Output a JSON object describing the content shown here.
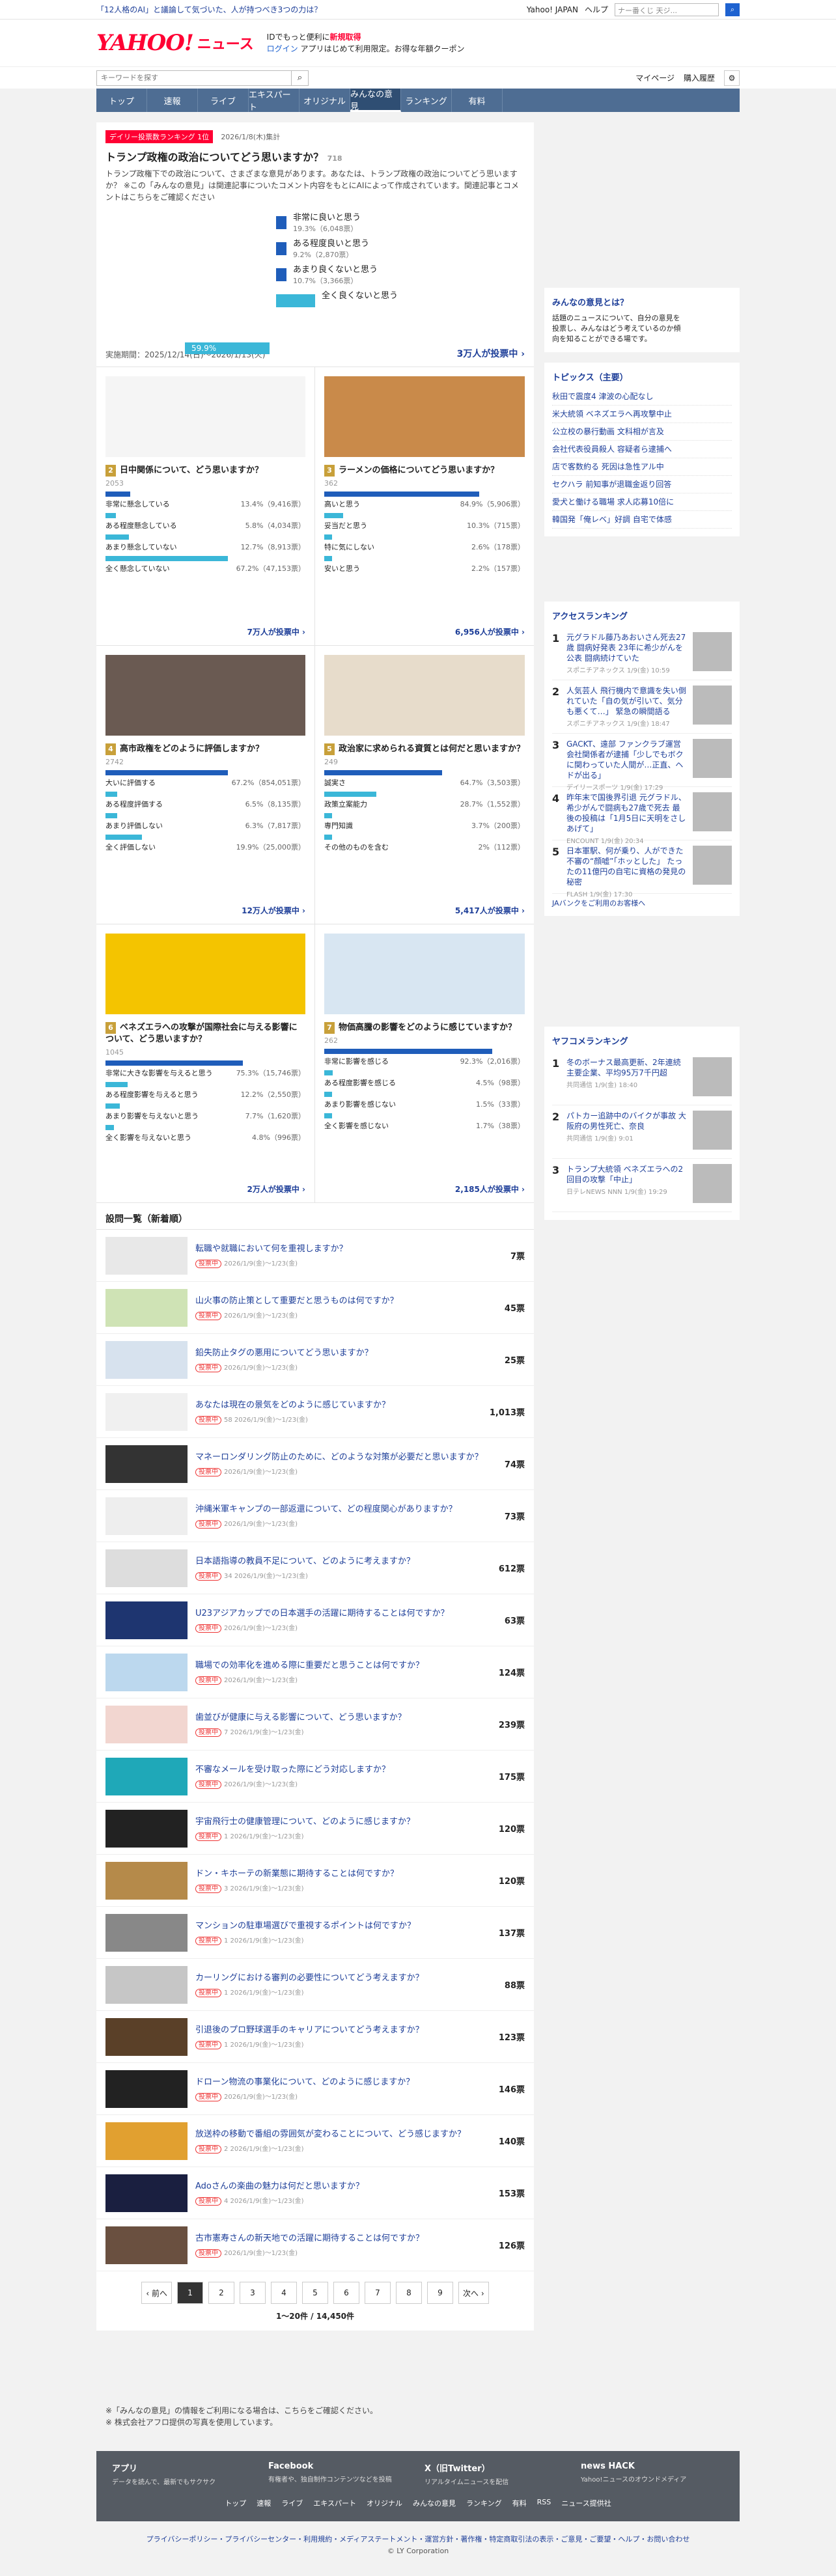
{
  "topbar": {
    "ad": "「12人格のAI」と議論して気づいた、人が持つべき3つの力は？",
    "links": [
      "Yahoo! JAPAN",
      "ヘルプ"
    ],
    "search_placeholder": "ウェブ検索",
    "search_hint": "ナー番くじ 天ジ..."
  },
  "header": {
    "logo": "YAHOO!",
    "logo_sub": "JAPAN",
    "service": "ニュース",
    "promo1": "IDでもっと便利に",
    "promo1b": "新規取得",
    "promo2": "ログイン",
    "promo3": "アプリはじめて利用限定。お得な年額クーポン"
  },
  "search": {
    "placeholder": "キーワードを探す",
    "mypage": "マイページ",
    "history": "購入履歴"
  },
  "nav": [
    "トップ",
    "速報",
    "ライブ",
    "エキスパート",
    "オリジナル",
    "みんなの意見",
    "ランキング",
    "有料"
  ],
  "featured": {
    "badge": "デイリー投票数ランキング 1位",
    "date": "2026/1/8(木)集計",
    "title": "トランプ政権の政治についてどう思いますか？",
    "count": "718",
    "desc": "トランプ政権下での政治について、さまざまな意見があります。あなたは、トランプ政権の政治についてどう思いますか？ ※この「みんなの意見」は関連記事についたコメント内容をもとにAIによって作成されています。関連記事とコメントはこちらをご確認ください",
    "options": [
      {
        "label": "非常に良いと思う",
        "pct": "19.3%（6,048票）",
        "v": 19.3
      },
      {
        "label": "ある程度良いと思う",
        "pct": "9.2%（2,870票）",
        "v": 9.2
      },
      {
        "label": "あまり良くないと思う",
        "pct": "10.7%（3,366票）",
        "v": 10.7
      },
      {
        "label": "全く良くないと思う",
        "pct": "",
        "v": 59.9
      }
    ],
    "highlight": "59.9%",
    "period": "実施期間：2025/12/14(日)〜2026/1/13(火)",
    "votes": "3万人が投票中 ›"
  },
  "cards": [
    {
      "num": "2",
      "title": "日中関係について、どう思いますか？",
      "meta": "2053",
      "rows": [
        [
          "非常に懸念している",
          "13.4%（9,416票）",
          13.4
        ],
        [
          "ある程度懸念している",
          "5.8%（4,034票）",
          5.8
        ],
        [
          "あまり懸念していない",
          "12.7%（8,913票）",
          12.7
        ],
        [
          "全く懸念していない",
          "67.2%（47,153票）",
          67.2
        ]
      ],
      "total": "7万人が投票中 ›"
    },
    {
      "num": "3",
      "title": "ラーメンの価格についてどう思いますか？",
      "meta": "362",
      "rows": [
        [
          "高いと思う",
          "84.9%（5,906票）",
          84.9
        ],
        [
          "妥当だと思う",
          "10.3%（715票）",
          10.3
        ],
        [
          "特に気にしない",
          "2.6%（178票）",
          2.6
        ],
        [
          "安いと思う",
          "2.2%（157票）",
          2.2
        ]
      ],
      "total": "6,956人が投票中 ›"
    },
    {
      "num": "4",
      "title": "高市政権をどのように評価しますか？",
      "meta": "2742",
      "rows": [
        [
          "大いに評価する",
          "67.2%（854,051票）",
          67.2
        ],
        [
          "ある程度評価する",
          "6.5%（8,135票）",
          6.5
        ],
        [
          "あまり評価しない",
          "6.3%（7,817票）",
          6.3
        ],
        [
          "全く評価しない",
          "19.9%（25,000票）",
          19.9
        ]
      ],
      "total": "12万人が投票中 ›"
    },
    {
      "num": "5",
      "title": "政治家に求められる資質とは何だと思いますか？",
      "meta": "249",
      "rows": [
        [
          "誠実さ",
          "64.7%（3,503票）",
          64.7
        ],
        [
          "政策立案能力",
          "28.7%（1,552票）",
          28.7
        ],
        [
          "専門知識",
          "3.7%（200票）",
          3.7
        ],
        [
          "その他のものを含む",
          "2%（112票）",
          2
        ]
      ],
      "total": "5,417人が投票中 ›"
    },
    {
      "num": "6",
      "title": "ベネズエラへの攻撃が国際社会に与える影響について、どう思いますか？",
      "meta": "1045",
      "rows": [
        [
          "非常に大きな影響を与えると思う",
          "75.3%（15,746票）",
          75.3
        ],
        [
          "ある程度影響を与えると思う",
          "12.2%（2,550票）",
          12.2
        ],
        [
          "あまり影響を与えないと思う",
          "7.7%（1,620票）",
          7.7
        ],
        [
          "全く影響を与えないと思う",
          "4.8%（996票）",
          4.8
        ]
      ],
      "total": "2万人が投票中 ›"
    },
    {
      "num": "7",
      "title": "物価高騰の影響をどのように感じていますか？",
      "meta": "262",
      "rows": [
        [
          "非常に影響を感じる",
          "92.3%（2,016票）",
          92.3
        ],
        [
          "ある程度影響を感じる",
          "4.5%（98票）",
          4.5
        ],
        [
          "あまり影響を感じない",
          "1.5%（33票）",
          1.5
        ],
        [
          "全く影響を感じない",
          "1.7%（38票）",
          1.7
        ]
      ],
      "total": "2,185人が投票中 ›"
    }
  ],
  "list_title": "設問一覧（新着順）",
  "list": [
    {
      "t": "転職や就職において何を重視しますか？",
      "m": "2026/1/9(金)〜1/23(金)",
      "v": "7票"
    },
    {
      "t": "山火事の防止策として重要だと思うものは何ですか？",
      "m": "2026/1/9(金)〜1/23(金)",
      "v": "45票"
    },
    {
      "t": "鉛失防止タグの悪用についてどう思いますか？",
      "m": "2026/1/9(金)〜1/23(金)",
      "v": "25票"
    },
    {
      "t": "あなたは現在の景気をどのように感じていますか？",
      "m": "58 2026/1/9(金)〜1/23(金)",
      "v": "1,013票"
    },
    {
      "t": "マネーロンダリング防止のために、どのような対策が必要だと思いますか？",
      "m": "2026/1/9(金)〜1/23(金)",
      "v": "74票"
    },
    {
      "t": "沖縄米軍キャンプの一部返還について、どの程度関心がありますか？",
      "m": "2026/1/9(金)〜1/23(金)",
      "v": "73票"
    },
    {
      "t": "日本語指導の教員不足について、どのように考えますか？",
      "m": "34 2026/1/9(金)〜1/23(金)",
      "v": "612票"
    },
    {
      "t": "U23アジアカップでの日本選手の活躍に期待することは何ですか？",
      "m": "2026/1/9(金)〜1/23(金)",
      "v": "63票"
    },
    {
      "t": "職場での効率化を進める際に重要だと思うことは何ですか？",
      "m": "2026/1/9(金)〜1/23(金)",
      "v": "124票"
    },
    {
      "t": "歯並びが健康に与える影響について、どう思いますか？",
      "m": "7 2026/1/9(金)〜1/23(金)",
      "v": "239票"
    },
    {
      "t": "不審なメールを受け取った際にどう対応しますか？",
      "m": "2026/1/9(金)〜1/23(金)",
      "v": "175票"
    },
    {
      "t": "宇宙飛行士の健康管理について、どのように感じますか？",
      "m": "1 2026/1/9(金)〜1/23(金)",
      "v": "120票"
    },
    {
      "t": "ドン・キホーテの新業態に期待することは何ですか？",
      "m": "3 2026/1/9(金)〜1/23(金)",
      "v": "120票"
    },
    {
      "t": "マンションの駐車場選びで重視するポイントは何ですか？",
      "m": "1 2026/1/9(金)〜1/23(金)",
      "v": "137票"
    },
    {
      "t": "カーリングにおける審判の必要性についてどう考えますか？",
      "m": "1 2026/1/9(金)〜1/23(金)",
      "v": "88票"
    },
    {
      "t": "引退後のプロ野球選手のキャリアについてどう考えますか？",
      "m": "1 2026/1/9(金)〜1/23(金)",
      "v": "123票"
    },
    {
      "t": "ドローン物流の事業化について、どのように感じますか？",
      "m": "2026/1/9(金)〜1/23(金)",
      "v": "146票"
    },
    {
      "t": "放送枠の移動で番組の雰囲気が変わることについて、どう感じますか？",
      "m": "2 2026/1/9(金)〜1/23(金)",
      "v": "140票"
    },
    {
      "t": "Adoさんの楽曲の魅力は何だと思いますか？",
      "m": "4 2026/1/9(金)〜1/23(金)",
      "v": "153票"
    },
    {
      "t": "古市憲寿さんの新天地での活躍に期待することは何ですか？",
      "m": "2026/1/9(金)〜1/23(金)",
      "v": "126票"
    }
  ],
  "pager": {
    "prev": "‹ 前へ",
    "pages": [
      "1",
      "2",
      "3",
      "4",
      "5",
      "6",
      "7",
      "8",
      "9"
    ],
    "next": "次へ ›",
    "count": "1〜20件 / 14,450件"
  },
  "notes": [
    "※「みんなの意見」の情報をご利用になる場合は、こちらをご確認ください。",
    "※ 株式会社アフロ提供の写真を使用しています。"
  ],
  "side": {
    "about_title": "みんなの意見とは？",
    "about": "話題のニュースについて、自分の意見を投票し、みんなはどう考えているのか傾向を知ることができる場です。",
    "topics_title": "トピックス（主要）",
    "topics": [
      "秋田で震度4 津波の心配なし",
      "米大統領 ベネズエラへ再攻撃中止",
      "公立校の暴行動画 文科相が言及",
      "会社代表役員殺人 容疑者ら逮捕へ",
      "店で客数約る 死因は急性アル中",
      "セクハラ 前知事が退職金返り回答",
      "愛犬と働ける職場 求人応募10倍に",
      "韓国発「俺レベ」好調 自宅で体感"
    ],
    "access_title": "アクセスランキング",
    "access": [
      {
        "t": "元グラドル藤乃あおいさん死去27歳 闘病好発表 23年に希少がんを公表 闘病続けていた",
        "s": "スポニチアネックス 1/9(金) 10:59"
      },
      {
        "t": "人気芸人 飛行機内で意識を失い倒れていた「自の気が引いて、気分も悪くて…」 緊急の瞬間語る",
        "s": "スポニチアネックス 1/9(金) 18:47"
      },
      {
        "t": "GACKT、遠部 ファンクラブ運営会社関係者が逮捕「少しでもボクに関わっていた人間が…正直、ヘドが出る」",
        "s": "デイリースポーツ 1/9(金) 17:29"
      },
      {
        "t": "昨年末で国後界引退 元グラドル、希少がんで闘病も27歳で死去 最後の投稿は「1月5日に天明をさしあげて」",
        "s": "ENCOUNT 1/9(金) 20:34"
      },
      {
        "t": "日本軍駅、何が乗り、人ができた不審の“顔嘘”「ホッとした」 たったの11億円の自宅に資格の発見の秘密",
        "s": "FLASH 1/9(金) 17:30"
      }
    ],
    "yafuko_title": "ヤフコメランキング",
    "yafuko": [
      {
        "t": "冬のボーナス最高更新、2年連続 主要企業、平均95万7千円超",
        "s": "共同通信 1/9(金) 18:40"
      },
      {
        "t": "パトカー追跡中のバイクが事故 大阪府の男性死亡、奈良",
        "s": "共同通信 1/9(金) 9:01"
      },
      {
        "t": "トランプ大統領 ベネズエラへの2回目の攻撃「中止」",
        "s": "日テレNEWS NNN 1/9(金) 19:29"
      }
    ],
    "pr": "JAバンクをご利用のお客様へ"
  },
  "footer": {
    "cols": [
      {
        "b": "アプリ",
        "s": "データを読んで、最新でもサクサク"
      },
      {
        "b": "Facebook",
        "s": "有権者や、独自制作コンテンツなどを投稿"
      },
      {
        "b": "X（旧Twitter）",
        "s": "リアルタイムニュースを配信"
      },
      {
        "b": "news HACK",
        "s": "Yahoo!ニュースのオウンドメディア"
      }
    ],
    "links": [
      "トップ",
      "速報",
      "ライブ",
      "エキスパート",
      "オリジナル",
      "みんなの意見",
      "ランキング",
      "有料",
      "RSS",
      "ニュース提供社"
    ],
    "bottom": "プライバシーポリシー・プライバシーセンター・利用規約・メディアステートメント・運営方針・著作権・特定商取引法の表示・ご意見・ご要望・ヘルプ・お問い合わせ",
    "copy": "© LY Corporation"
  },
  "colors": {
    "accent": "#1f5dba",
    "brand": "#ff0033",
    "nav": "#4e6d93"
  }
}
